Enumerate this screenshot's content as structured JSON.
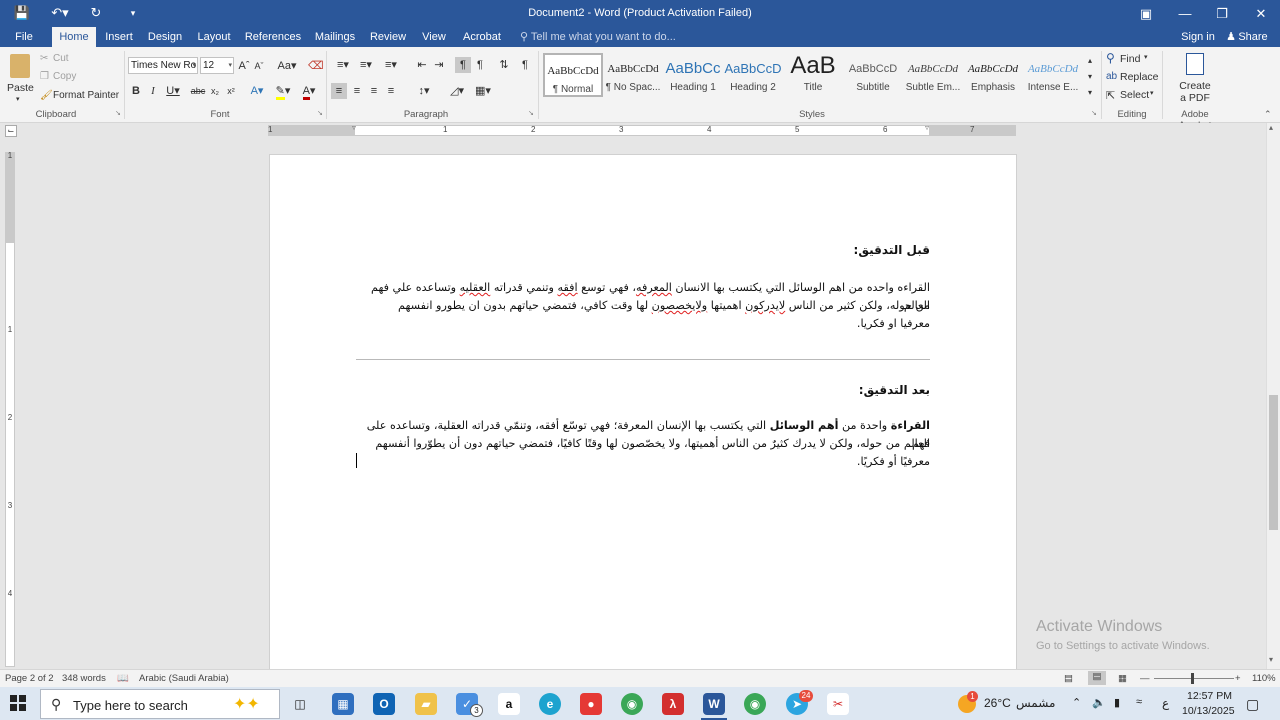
{
  "titlebar": {
    "title": "Document2 - Word (Product Activation Failed)"
  },
  "tabs": [
    "File",
    "Home",
    "Insert",
    "Design",
    "Layout",
    "References",
    "Mailings",
    "Review",
    "View",
    "Acrobat"
  ],
  "tell_me": "Tell me what you want to do...",
  "account": {
    "sign_in": "Sign in",
    "share": "Share"
  },
  "clipboard": {
    "paste": "Paste",
    "cut": "Cut",
    "copy": "Copy",
    "format_painter": "Format Painter",
    "label": "Clipboard"
  },
  "font": {
    "name": "Times New Ro",
    "size": "12",
    "label": "Font"
  },
  "paragraph": {
    "label": "Paragraph"
  },
  "styles": {
    "label": "Styles",
    "items": [
      {
        "preview": "AaBbCcDd",
        "name": "¶ Normal"
      },
      {
        "preview": "AaBbCcDd",
        "name": "¶ No Spac..."
      },
      {
        "preview": "AaBbCc",
        "name": "Heading 1"
      },
      {
        "preview": "AaBbCcD",
        "name": "Heading 2"
      },
      {
        "preview": "AaB",
        "name": "Title"
      },
      {
        "preview": "AaBbCcD",
        "name": "Subtitle"
      },
      {
        "preview": "AaBbCcDd",
        "name": "Subtle Em..."
      },
      {
        "preview": "AaBbCcDd",
        "name": "Emphasis"
      },
      {
        "preview": "AaBbCcDd",
        "name": "Intense E..."
      }
    ]
  },
  "editing": {
    "find": "Find",
    "replace": "Replace",
    "select": "Select",
    "label": "Editing"
  },
  "acrobat": {
    "create_pdf_line1": "Create",
    "create_pdf_line2": "a PDF",
    "label": "Adobe Acrobat"
  },
  "ruler": {
    "h_numbers": [
      "1",
      "1",
      "2",
      "3",
      "4",
      "5",
      "6",
      "7"
    ],
    "v_numbers": [
      "1",
      "1",
      "2",
      "3",
      "4"
    ]
  },
  "document": {
    "before_heading": "قبل التدقيق:",
    "before_lines": [
      "القراءه واحده من اهم الوسائل التي يكتسب بها الانسان المعرفه، فهي توسع افقه وتنمي قدراته العقليه وتساعده علي فهم العالم",
      "من حوله، ولكن كثير من الناس لايدركون اهميتها ولايخصصون لها وقت كافي، فتمضي حياتهم بدون ان يطورو انفسهم",
      "معرفيا او فكريا."
    ],
    "after_heading": "بعد التدقيق:",
    "after_bold1": "القراءة",
    "after_mid1": "واحدة من",
    "after_bold2": "أهم الوسائل",
    "after_rest1": "التي يكتسب بها الإنسان المعرفة؛ فهي توسّع أفقه، وتنمّي قدراته العقلية، وتساعده على فهم",
    "after_line2": "العالم من حوله، ولكن لا يدرك كثيرٌ من الناس أهميتها، ولا يخصّصون لها وقتًا كافيًا، فتمضي حياتهم دون أن يطوّروا أنفسهم",
    "after_line3": "معرفيًا أو فكريًا."
  },
  "watermark": {
    "line1": "Activate Windows",
    "line2": "Go to Settings to activate Windows."
  },
  "status": {
    "page": "Page 2 of 2",
    "words": "348 words",
    "language": "Arabic (Saudi Arabia)",
    "zoom": "110%",
    "zoom_level": 1.1
  },
  "taskbar": {
    "search_placeholder": "Type here to search",
    "weather_temp": "26°C",
    "weather_text": "مشمس",
    "weather_badge": "1",
    "lang": "ع",
    "time": "12:57 PM",
    "date": "10/13/2025",
    "task_badge": "3",
    "telegram_badge": "24"
  },
  "colors": {
    "accent": "#2b579a",
    "spell_error": "#e02020"
  }
}
